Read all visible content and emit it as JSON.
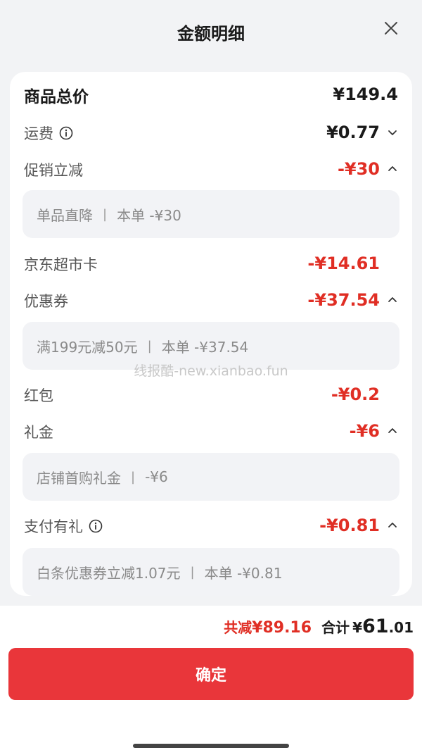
{
  "title": "金额明细",
  "rows": {
    "total": {
      "label": "商品总价",
      "value": "¥149.4"
    },
    "shipping": {
      "label": "运费",
      "value": "¥0.77"
    },
    "promo": {
      "label": "促销立减",
      "value": "-¥30"
    },
    "promo_detail": {
      "left": "单品直降",
      "sep": "|",
      "right": "本单 -¥30"
    },
    "market_card": {
      "label": "京东超市卡",
      "value": "-¥14.61"
    },
    "coupon": {
      "label": "优惠券",
      "value": "-¥37.54"
    },
    "coupon_detail": {
      "left": "满199元减50元",
      "sep": "|",
      "right": "本单 -¥37.54"
    },
    "red_packet": {
      "label": "红包",
      "value": "-¥0.2"
    },
    "gift_money": {
      "label": "礼金",
      "value": "-¥6"
    },
    "gift_detail": {
      "left": "店铺首购礼金",
      "sep": "|",
      "right": "-¥6"
    },
    "pay_gift": {
      "label": "支付有礼",
      "value": "-¥0.81"
    },
    "pay_detail": {
      "left": "白条优惠券立减1.07元",
      "sep": "|",
      "right": "本单 -¥0.81"
    }
  },
  "watermark": "线报酷-new.xianbao.fun",
  "footer": {
    "reduce_label": "共减",
    "reduce_value": "¥89.16",
    "total_label": "合计",
    "total_currency": "¥",
    "total_int": "61",
    "total_dec": ".01",
    "confirm_label": "确定"
  },
  "colors": {
    "accent": "#e02e24",
    "button": "#e9363a",
    "background": "#f2f3f5",
    "card": "#ffffff",
    "subbox": "#f2f3f6"
  },
  "icons": [
    "close-icon",
    "info-icon",
    "chevron-down-icon",
    "chevron-up-icon"
  ]
}
